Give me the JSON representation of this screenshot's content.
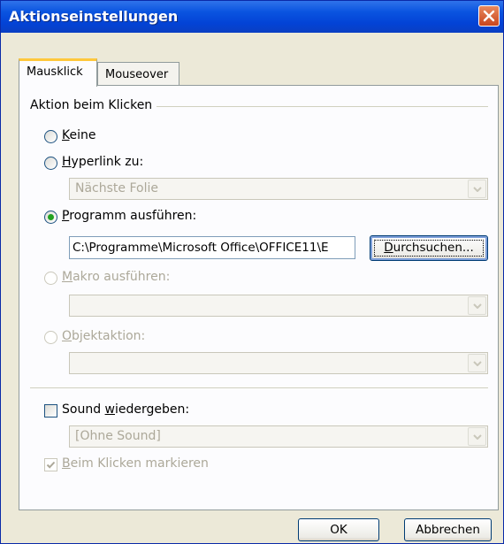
{
  "dialog": {
    "title": "Aktionseinstellungen"
  },
  "tabs": [
    {
      "label": "Mausklick",
      "active": true
    },
    {
      "label": "Mouseover",
      "active": false
    }
  ],
  "group": {
    "label": "Aktion beim Klicken"
  },
  "options": {
    "none": {
      "accel": "K",
      "rest": "eine",
      "selected": false
    },
    "hyperlink": {
      "accel": "H",
      "rest": "yperlink zu:",
      "selected": false,
      "select_value": "Nächste Folie"
    },
    "program": {
      "accel": "P",
      "rest": "rogramm ausführen:",
      "selected": true,
      "path_value": "C:\\Programme\\Microsoft Office\\OFFICE11\\E",
      "browse_accel": "D",
      "browse_rest": "urchsuchen..."
    },
    "macro": {
      "accel": "M",
      "rest": "akro ausführen:",
      "selected": false,
      "disabled": true,
      "select_value": ""
    },
    "object": {
      "accel": "O",
      "rest": "bjektaktion:",
      "selected": false,
      "disabled": true,
      "select_value": ""
    }
  },
  "sound": {
    "label_pre": "Sound ",
    "accel": "w",
    "label_post": "iedergeben:",
    "checked": false,
    "select_value": "[Ohne Sound]"
  },
  "highlight": {
    "accel": "B",
    "rest": "eim Klicken markieren",
    "checked": true,
    "disabled": true
  },
  "buttons": {
    "ok": "OK",
    "cancel": "Abbrechen"
  },
  "colors": {
    "titlebar": "#0a54e0",
    "dialog_bg": "#ece9d8",
    "radio_dot": "#21a121",
    "close_button": "#c8451d"
  }
}
